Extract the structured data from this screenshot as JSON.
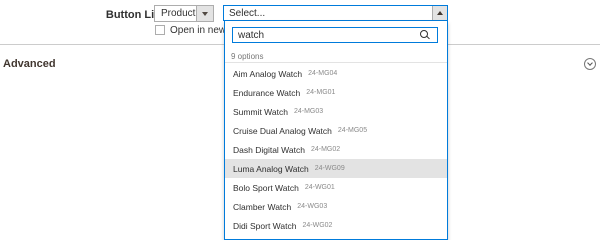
{
  "form": {
    "button_link_label": "Button Link",
    "link_type": "Product",
    "open_new_tab_label": "Open in new tab",
    "open_new_tab_checked": false
  },
  "section": {
    "title": "Advanced",
    "toggle_icon": "chevron-down-circle-icon"
  },
  "product_select": {
    "value": "Select...",
    "search_value": "watch",
    "search_icon": "search-icon",
    "count_text": "9 options",
    "highlighted_index": 5,
    "options": [
      {
        "name": "Aim Analog Watch",
        "sku": "24-MG04"
      },
      {
        "name": "Endurance Watch",
        "sku": "24-MG01"
      },
      {
        "name": "Summit Watch",
        "sku": "24-MG03"
      },
      {
        "name": "Cruise Dual Analog Watch",
        "sku": "24-MG05"
      },
      {
        "name": "Dash Digital Watch",
        "sku": "24-MG02"
      },
      {
        "name": "Luma Analog Watch",
        "sku": "24-WG09"
      },
      {
        "name": "Bolo Sport Watch",
        "sku": "24-WG01"
      },
      {
        "name": "Clamber Watch",
        "sku": "24-WG03"
      },
      {
        "name": "Didi Sport Watch",
        "sku": "24-WG02"
      }
    ]
  },
  "colors": {
    "focus_border": "#007bdb",
    "highlight_bg": "#e3e3e3",
    "sku_text": "#8a8a8a"
  }
}
